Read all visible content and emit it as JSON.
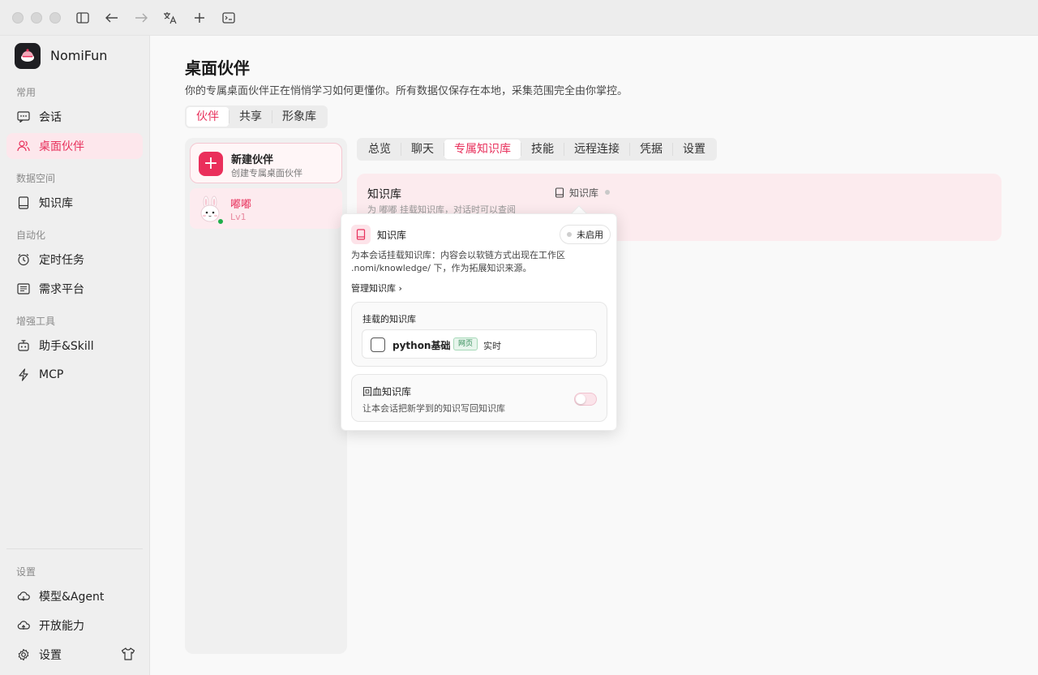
{
  "app": {
    "name": "NomiFun"
  },
  "sidebar": {
    "sections": [
      {
        "label": "常用"
      },
      {
        "label": "数据空间"
      },
      {
        "label": "自动化"
      },
      {
        "label": "增强工具"
      },
      {
        "label": "设置"
      }
    ],
    "items": [
      {
        "label": "会话",
        "icon": "chat-icon"
      },
      {
        "label": "桌面伙伴",
        "icon": "partner-icon",
        "active": true
      },
      {
        "label": "知识库",
        "icon": "book-icon"
      },
      {
        "label": "定时任务",
        "icon": "clock-icon"
      },
      {
        "label": "需求平台",
        "icon": "list-icon"
      },
      {
        "label": "助手&Skill",
        "icon": "robot-icon"
      },
      {
        "label": "MCP",
        "icon": "bolt-icon"
      },
      {
        "label": "模型&Agent",
        "icon": "cloud-icon"
      },
      {
        "label": "开放能力",
        "icon": "cloud-icon"
      },
      {
        "label": "设置",
        "icon": "gear-icon"
      }
    ]
  },
  "page": {
    "title": "桌面伙伴",
    "subtitle": "你的专属桌面伙伴正在悄悄学习如何更懂你。所有数据仅保存在本地，采集范围完全由你掌控。",
    "segments": [
      "伙伴",
      "共享",
      "形象库"
    ],
    "selected_segment": "伙伴"
  },
  "partners": {
    "new_title": "新建伙伴",
    "new_subtitle": "创建专属桌面伙伴",
    "list": [
      {
        "name": "嘟嘟",
        "level": "Lv1",
        "online": true
      }
    ]
  },
  "tabs": {
    "items": [
      "总览",
      "聊天",
      "专属知识库",
      "技能",
      "远程连接",
      "凭据",
      "设置"
    ],
    "selected": "专属知识库"
  },
  "kb_card": {
    "title": "知识库",
    "desc": "为 嘟嘟 挂载知识库，对话时可以查阅",
    "badge": "知识库"
  },
  "popover": {
    "title": "知识库",
    "status": "未启用",
    "desc": "为本会话挂载知识库：内容会以软链方式出现在工作区 .nomi/knowledge/ 下，作为拓展知识来源。",
    "manage_link": "管理知识库 ›",
    "mounted_title": "挂载的知识库",
    "mounted": [
      {
        "name": "python基础",
        "tag": "网页",
        "mode": "实时",
        "checked": false
      }
    ],
    "blood_title": "回血知识库",
    "blood_sub": "让本会话把新学到的知识写回知识库",
    "blood_enabled": false
  },
  "colors": {
    "accent": "#e8315c",
    "online": "#1fae4a"
  }
}
